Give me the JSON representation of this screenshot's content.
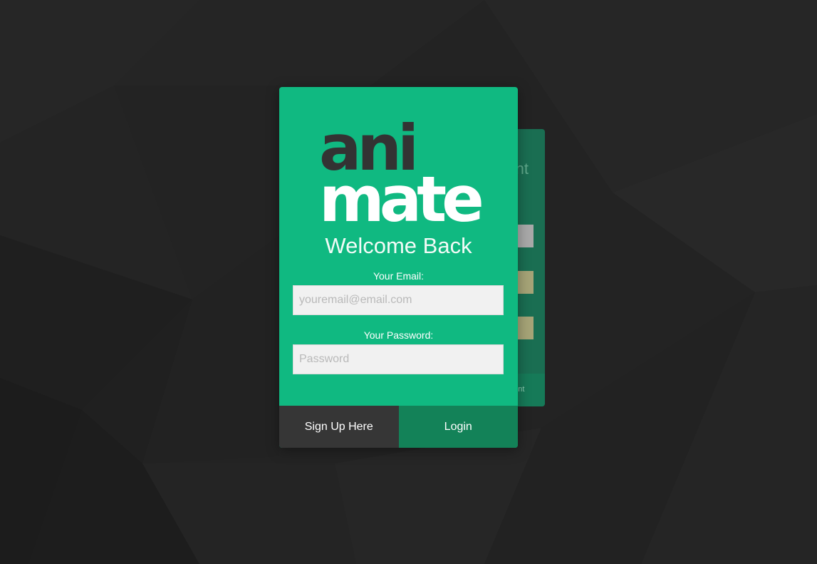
{
  "logo": {
    "line1": "ani",
    "line2": "mate"
  },
  "login_card": {
    "heading": "Welcome Back",
    "email_label": "Your Email:",
    "email_placeholder": "youremail@email.com",
    "email_value": "",
    "password_label": "Your Password:",
    "password_placeholder": "Password",
    "password_value": "",
    "signup_button": "Sign Up Here",
    "login_button": "Login"
  },
  "signup_card_peek": {
    "title_fragment": "nt",
    "footer_fragment": "ount"
  },
  "colors": {
    "background": "#222222",
    "card_green": "#10b981",
    "login_button": "#138258",
    "signup_button": "#363636",
    "logo_dark": "#333333",
    "logo_light": "#ffffff"
  }
}
